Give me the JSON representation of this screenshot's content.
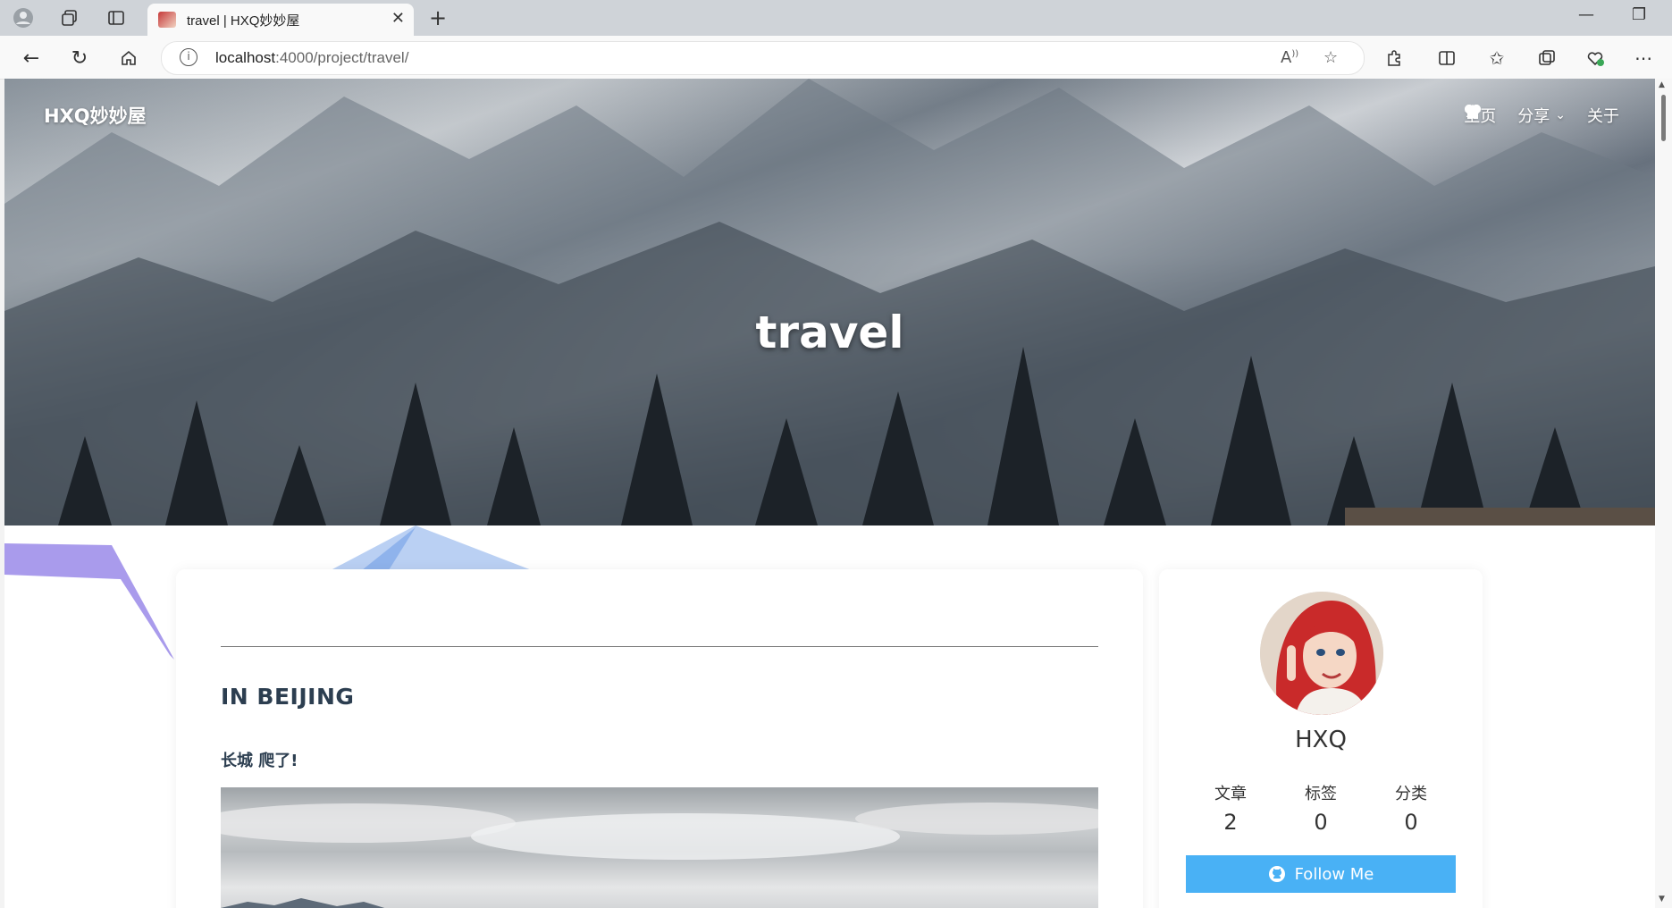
{
  "browser": {
    "tab_title": "travel | HXQ妙妙屋",
    "url_host": "localhost",
    "url_rest": ":4000/project/travel/"
  },
  "site": {
    "brand": "HXQ妙妙屋",
    "nav": [
      {
        "label": "主页",
        "icon": "home-icon"
      },
      {
        "label": "分享",
        "icon": "heartbeat-icon",
        "has_dropdown": true
      },
      {
        "label": "关于",
        "icon": "heart-icon"
      }
    ],
    "page_title": "travel"
  },
  "post": {
    "heading": "IN BEIJING",
    "subheading": "长城 爬了!"
  },
  "profile": {
    "name": "HXQ",
    "stats": [
      {
        "label": "文章",
        "value": "2"
      },
      {
        "label": "标签",
        "value": "0"
      },
      {
        "label": "分类",
        "value": "0"
      }
    ],
    "follow_label": "Follow Me",
    "follow_color": "#49b1f5"
  }
}
